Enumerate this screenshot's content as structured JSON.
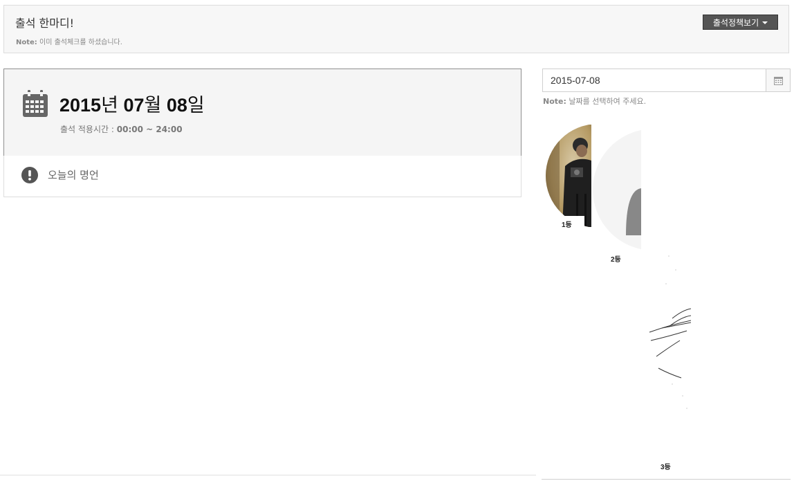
{
  "header": {
    "title": "출석 한마디!",
    "note_label": "Note:",
    "note_text": "이미 출석체크를 하셨습니다.",
    "policy_button": "출석정책보기"
  },
  "date_panel": {
    "year": "2015",
    "year_unit": "년",
    "month": "07",
    "month_unit": "월",
    "day": "08",
    "day_unit": "일",
    "sub_label": "출석 적용시간 :",
    "time_range": "00:00 ~ 24:00"
  },
  "quote": {
    "label": "오늘의 명언"
  },
  "date_picker": {
    "value": "2015-07-08",
    "note_label": "Note:",
    "note_text": "날짜를 선택하여 주세요."
  },
  "ranks": [
    {
      "label": "1등"
    },
    {
      "label": "2등"
    },
    {
      "label": "3등"
    }
  ],
  "colors": {
    "button_bg": "#555555",
    "panel_bg": "#f5f5f5",
    "icon_gray": "#666666"
  }
}
